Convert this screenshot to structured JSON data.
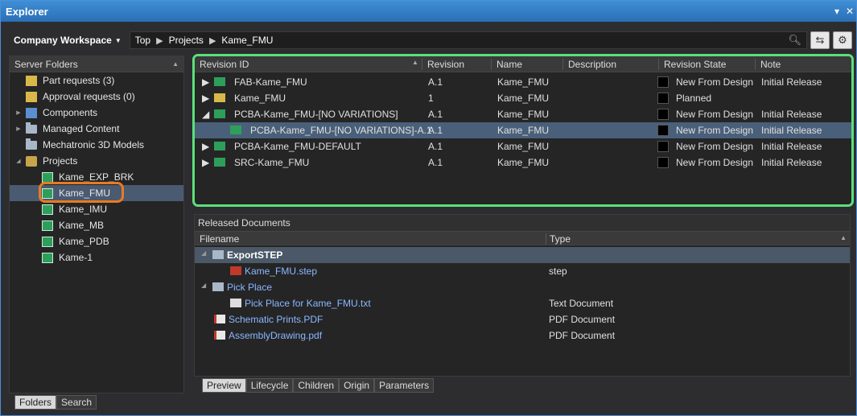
{
  "window": {
    "title": "Explorer",
    "pin": "▾",
    "close": "✕"
  },
  "toolbar": {
    "workspace": "Company Workspace",
    "breadcrumb": [
      "Top",
      "Projects",
      "Kame_FMU"
    ]
  },
  "left_panel": {
    "header": "Server Folders",
    "items": [
      {
        "label": "Part requests (3)",
        "icon": "part-requests-icon",
        "expander": ""
      },
      {
        "label": "Approval requests (0)",
        "icon": "approval-icon",
        "expander": ""
      },
      {
        "label": "Components",
        "icon": "components-icon",
        "expander": "▶"
      },
      {
        "label": "Managed Content",
        "icon": "folder-icon",
        "expander": "▶"
      },
      {
        "label": "Mechatronic 3D Models",
        "icon": "folder-icon",
        "expander": ""
      },
      {
        "label": "Projects",
        "icon": "projects-icon",
        "expander": "◢"
      },
      {
        "label": "Kame_EXP_BRK",
        "icon": "project-icon",
        "expander": ""
      },
      {
        "label": "Kame_FMU",
        "icon": "project-icon",
        "expander": ""
      },
      {
        "label": "Kame_IMU",
        "icon": "project-icon",
        "expander": ""
      },
      {
        "label": "Kame_MB",
        "icon": "project-icon",
        "expander": ""
      },
      {
        "label": "Kame_PDB",
        "icon": "project-icon",
        "expander": ""
      },
      {
        "label": "Kame-1",
        "icon": "project-icon",
        "expander": ""
      }
    ],
    "selected_index": 7,
    "tabs": [
      "Folders",
      "Search"
    ]
  },
  "revisions": {
    "columns": [
      "Revision ID",
      "Revision",
      "Name",
      "Description",
      "Revision State",
      "Note"
    ],
    "rows": [
      {
        "exp": "▶",
        "id": "FAB-Kame_FMU",
        "rev": "A.1",
        "name": "Kame_FMU",
        "desc": "",
        "state": "New From Design",
        "note": "Initial Release",
        "icon": "fab-icon"
      },
      {
        "exp": "▶",
        "id": "Kame_FMU",
        "rev": "1",
        "name": "Kame_FMU",
        "desc": "",
        "state": "Planned",
        "note": "",
        "icon": "plug-icon"
      },
      {
        "exp": "◢",
        "id": "PCBA-Kame_FMU-[NO VARIATIONS]",
        "rev": "A.1",
        "name": "Kame_FMU",
        "desc": "",
        "state": "New From Design",
        "note": "Initial Release",
        "icon": "pcba-icon"
      },
      {
        "exp": "",
        "id": "PCBA-Kame_FMU-[NO VARIATIONS]-A.1",
        "rev": "A.1",
        "name": "Kame_FMU",
        "desc": "",
        "state": "New From Design",
        "note": "Initial Release",
        "icon": "pcba-icon"
      },
      {
        "exp": "▶",
        "id": "PCBA-Kame_FMU-DEFAULT",
        "rev": "A.1",
        "name": "Kame_FMU",
        "desc": "",
        "state": "New From Design",
        "note": "Initial Release",
        "icon": "pcba-icon"
      },
      {
        "exp": "▶",
        "id": "SRC-Kame_FMU",
        "rev": "A.1",
        "name": "Kame_FMU",
        "desc": "",
        "state": "New From Design",
        "note": "Initial Release",
        "icon": "src-icon"
      }
    ],
    "selected_index": 3
  },
  "documents": {
    "title": "Released Documents",
    "columns": [
      "Filename",
      "Type"
    ],
    "rows": [
      {
        "exp": "◢",
        "name": "ExportSTEP",
        "type": "",
        "kind": "folder",
        "indent": 0
      },
      {
        "exp": "",
        "name": "Kame_FMU.step",
        "type": "step",
        "kind": "step",
        "indent": 1
      },
      {
        "exp": "◢",
        "name": "Pick Place",
        "type": "",
        "kind": "folder",
        "indent": 0
      },
      {
        "exp": "",
        "name": "Pick Place for Kame_FMU.txt",
        "type": "Text Document",
        "kind": "txt",
        "indent": 1
      },
      {
        "exp": "",
        "name": "Schematic Prints.PDF",
        "type": "PDF Document",
        "kind": "pdf",
        "indent": 0
      },
      {
        "exp": "",
        "name": "AssemblyDrawing.pdf",
        "type": "PDF Document",
        "kind": "pdf",
        "indent": 0
      }
    ],
    "tabs": [
      "Preview",
      "Lifecycle",
      "Children",
      "Origin",
      "Parameters"
    ]
  },
  "colors": {
    "accent": "#3f8fd6",
    "highlight_green": "#5be07a",
    "highlight_orange": "#e87a22"
  }
}
